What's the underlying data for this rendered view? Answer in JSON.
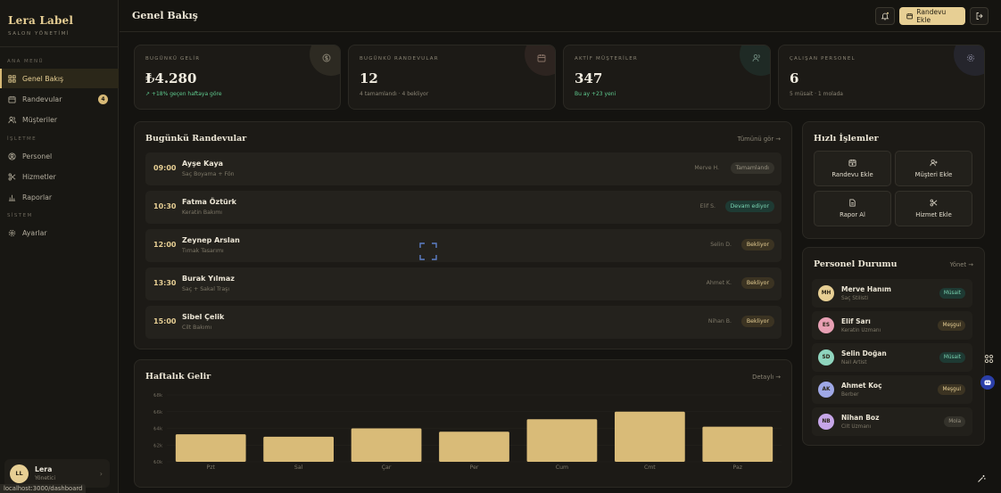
{
  "brand": {
    "name": "Lera Label",
    "subtitle": "SALON YÖNETİMİ"
  },
  "sidebar": {
    "sections": {
      "main": "ANA MENÜ",
      "ops": "İŞLETME",
      "system": "SİSTEM"
    },
    "items": [
      {
        "label": "Genel Bakış",
        "icon": "grid-icon",
        "active": true
      },
      {
        "label": "Randevular",
        "icon": "calendar-icon",
        "badge": "4"
      },
      {
        "label": "Müşteriler",
        "icon": "users-icon"
      },
      {
        "label": "Personel",
        "icon": "user-circle-icon"
      },
      {
        "label": "Hizmetler",
        "icon": "scissors-icon"
      },
      {
        "label": "Raporlar",
        "icon": "bar-chart-icon"
      },
      {
        "label": "Ayarlar",
        "icon": "gear-icon"
      }
    ],
    "user": {
      "initials": "LL",
      "name": "Lera",
      "role": "Yönetici"
    },
    "status_url": "localhost:3000/dashboard"
  },
  "header": {
    "title": "Genel Bakış",
    "add_appointment": "Randevu Ekle"
  },
  "stats": [
    {
      "label": "BUGÜNKÜ GELİR",
      "value": "₺4.280",
      "sub": "↗ +18% geçen haftaya göre",
      "sub_positive": true,
      "icon": "currency-icon",
      "accent": "#3a3528"
    },
    {
      "label": "BUGÜNKÜ RANDEVULAR",
      "value": "12",
      "sub": "4 tamamlandı · 4 bekliyor",
      "icon": "calendar-icon",
      "accent": "#3a2c26"
    },
    {
      "label": "AKTİF MÜŞTERİLER",
      "value": "347",
      "sub": "Bu ay +23 yeni",
      "sub_positive": true,
      "icon": "users-icon",
      "accent": "#22332c"
    },
    {
      "label": "ÇALIŞAN PERSONEL",
      "value": "6",
      "sub": "5 müsait · 1 molada",
      "icon": "gear-icon",
      "accent": "#2b2b35"
    }
  ],
  "appointments": {
    "title": "Bugünkü Randevular",
    "link": "Tümünü gör →",
    "rows": [
      {
        "time": "09:00",
        "name": "Ayşe Kaya",
        "service": "Saç Boyama + Fön",
        "staff": "Merve H.",
        "status": "Tamamlandı",
        "kind": "done"
      },
      {
        "time": "10:30",
        "name": "Fatma Öztürk",
        "service": "Keratin Bakımı",
        "staff": "Elif S.",
        "status": "Devam ediyor",
        "kind": "prog"
      },
      {
        "time": "12:00",
        "name": "Zeynep Arslan",
        "service": "Tırnak Tasarımı",
        "staff": "Selin D.",
        "status": "Bekliyor",
        "kind": "wait"
      },
      {
        "time": "13:30",
        "name": "Burak Yılmaz",
        "service": "Saç + Sakal Traşı",
        "staff": "Ahmet K.",
        "status": "Bekliyor",
        "kind": "wait"
      },
      {
        "time": "15:00",
        "name": "Sibel Çelik",
        "service": "Cilt Bakımı",
        "staff": "Nihan B.",
        "status": "Bekliyor",
        "kind": "wait"
      }
    ]
  },
  "quick_actions": {
    "title": "Hızlı İşlemler",
    "items": [
      {
        "label": "Randevu Ekle",
        "icon": "calendar-plus-icon"
      },
      {
        "label": "Müşteri Ekle",
        "icon": "user-plus-icon"
      },
      {
        "label": "Rapor Al",
        "icon": "document-icon"
      },
      {
        "label": "Hizmet Ekle",
        "icon": "scissors-icon"
      }
    ]
  },
  "staff": {
    "title": "Personel Durumu",
    "link": "Yönet →",
    "rows": [
      {
        "initials": "MH",
        "name": "Merve Hanım",
        "role": "Saç Stilisti",
        "status": "Müsait",
        "kind": "free",
        "color": "#e7cf94"
      },
      {
        "initials": "ES",
        "name": "Elif Sarı",
        "role": "Keratin Uzmanı",
        "status": "Meşgul",
        "kind": "busy",
        "color": "#e8a0b4"
      },
      {
        "initials": "SD",
        "name": "Selin Doğan",
        "role": "Nail Artist",
        "status": "Müsait",
        "kind": "free",
        "color": "#8fd5be"
      },
      {
        "initials": "AK",
        "name": "Ahmet Koç",
        "role": "Berber",
        "status": "Meşgul",
        "kind": "busy",
        "color": "#9fa8e6"
      },
      {
        "initials": "NB",
        "name": "Nihan Boz",
        "role": "Cilt Uzmanı",
        "status": "Mola",
        "kind": "break",
        "color": "#c6a6e8"
      }
    ]
  },
  "chart_data": {
    "type": "bar",
    "title": "Haftalık Gelir",
    "link": "Detaylı →",
    "categories": [
      "Pzt",
      "Sal",
      "Çar",
      "Per",
      "Cum",
      "Cmt",
      "Paz"
    ],
    "values": [
      3.3,
      3.0,
      4.0,
      3.6,
      5.1,
      6.0,
      4.2
    ],
    "y_ticks": [
      "₺0k",
      "₺2k",
      "₺4k",
      "₺6k",
      "₺8k"
    ],
    "ylim": [
      0,
      8
    ],
    "color": "#d9bb78"
  }
}
